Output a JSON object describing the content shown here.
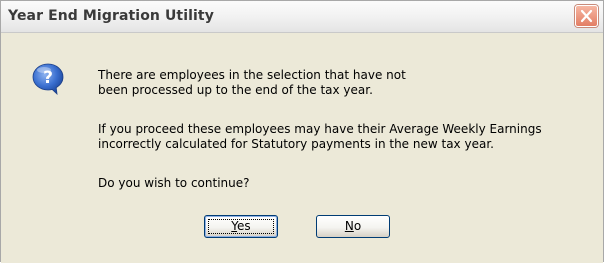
{
  "dialog": {
    "title": "Year End Migration Utility",
    "icon": "question-icon",
    "message": {
      "line1": "There are employees in the selection that have not",
      "line2": "been processed up to the end of the tax year.",
      "line3": "If you proceed these employees may have their Average Weekly Earnings",
      "line4": "incorrectly calculated for Statutory payments in the new tax year.",
      "line5": "Do you wish to continue?"
    },
    "buttons": {
      "yes": {
        "accel": "Y",
        "rest": "es"
      },
      "no": {
        "accel": "N",
        "rest": "o"
      }
    },
    "colors": {
      "face": "#ece9d8",
      "close": "#e37e64",
      "icon": "#2f5fb8"
    }
  }
}
